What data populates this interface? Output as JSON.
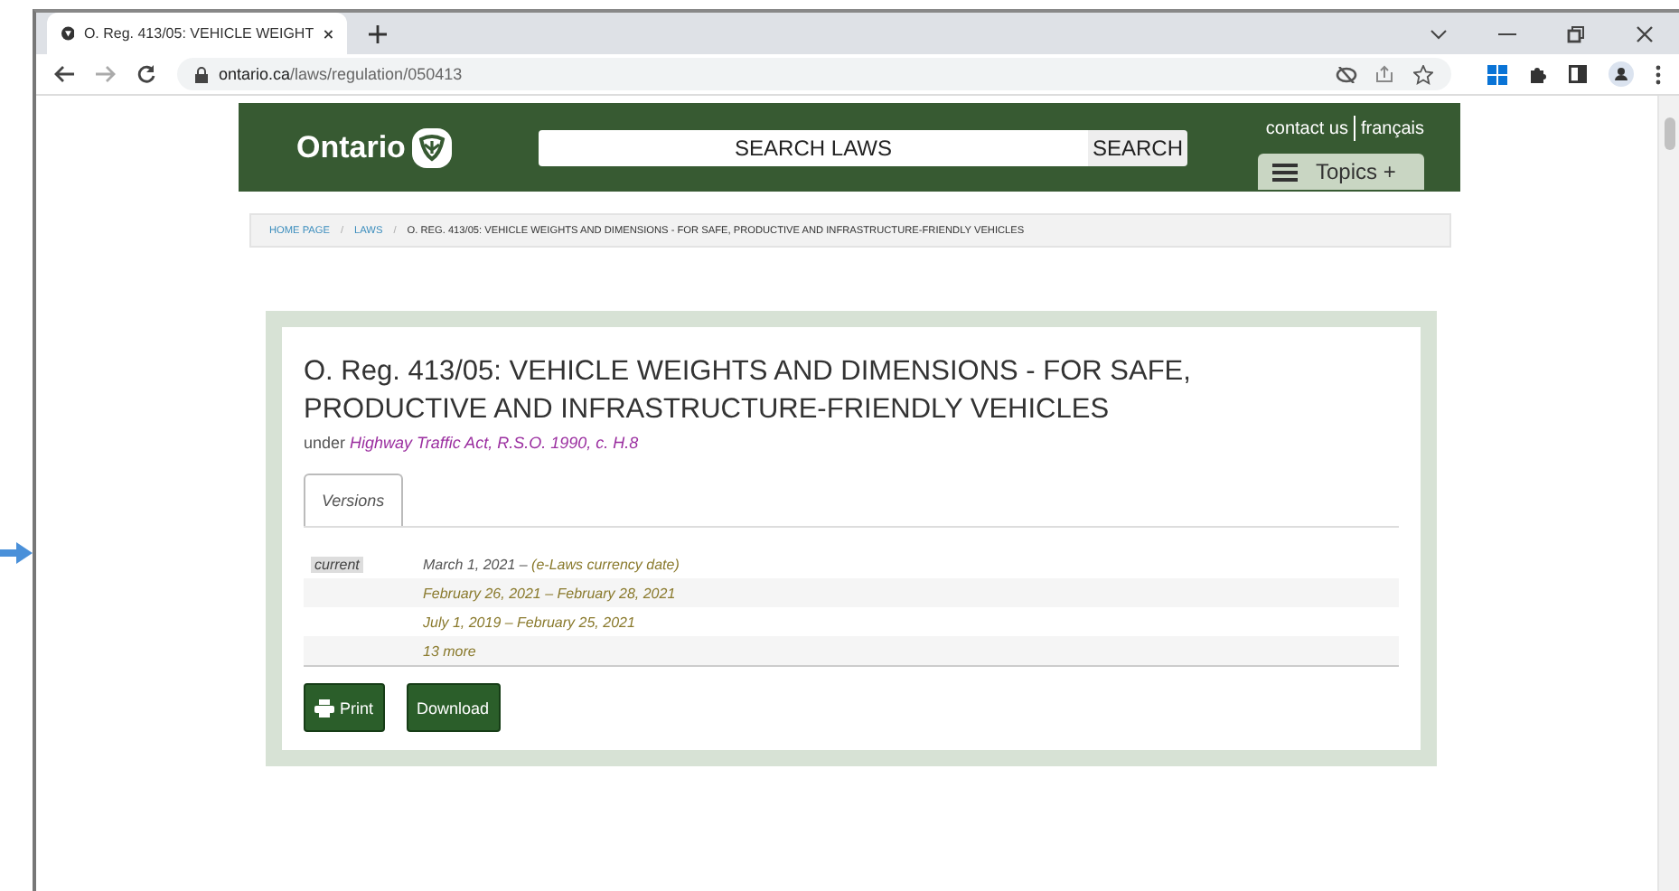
{
  "browser": {
    "tab_title": "O. Reg. 413/05: VEHICLE WEIGHT",
    "url_host": "ontario.ca",
    "url_path": "/laws/regulation/050413"
  },
  "header": {
    "logo": "Ontario",
    "search_placeholder": "SEARCH LAWS",
    "search_button": "SEARCH",
    "links": [
      "contact us",
      "français"
    ],
    "topics": "Topics +"
  },
  "breadcrumb_separator": [
    "/",
    "/"
  ],
  "breadcrumb": [
    {
      "label": "HOME PAGE",
      "link": true
    },
    {
      "label": "LAWS",
      "link": true
    },
    {
      "label": "O. REG. 413/05: VEHICLE WEIGHTS AND DIMENSIONS - FOR SAFE, PRODUCTIVE AND INFRASTRUCTURE-FRIENDLY VEHICLES",
      "link": false
    }
  ],
  "document": {
    "title": "O. Reg. 413/05: VEHICLE WEIGHTS AND DIMENSIONS - FOR SAFE, PRODUCTIVE AND INFRASTRUCTURE-FRIENDLY VEHICLES",
    "under": "under",
    "act": "Highway Traffic Act, R.S.O. 1990, c. H.8",
    "tabs": [
      {
        "label": "Versions",
        "selected": true
      }
    ],
    "current_badge": "current",
    "versions": [
      {
        "dates": "March 1, 2021 – ",
        "note": "(e-Laws currency date)",
        "current": true
      },
      {
        "dates": "February 26, 2021 – February 28, 2021",
        "current": false
      },
      {
        "dates": "July 1, 2019 – February 25, 2021",
        "current": false
      },
      {
        "dates": "13 more",
        "current": false
      }
    ],
    "buttons": [
      {
        "label": "Print",
        "kind": "print"
      },
      {
        "label": "Download",
        "kind": "plain"
      }
    ]
  }
}
